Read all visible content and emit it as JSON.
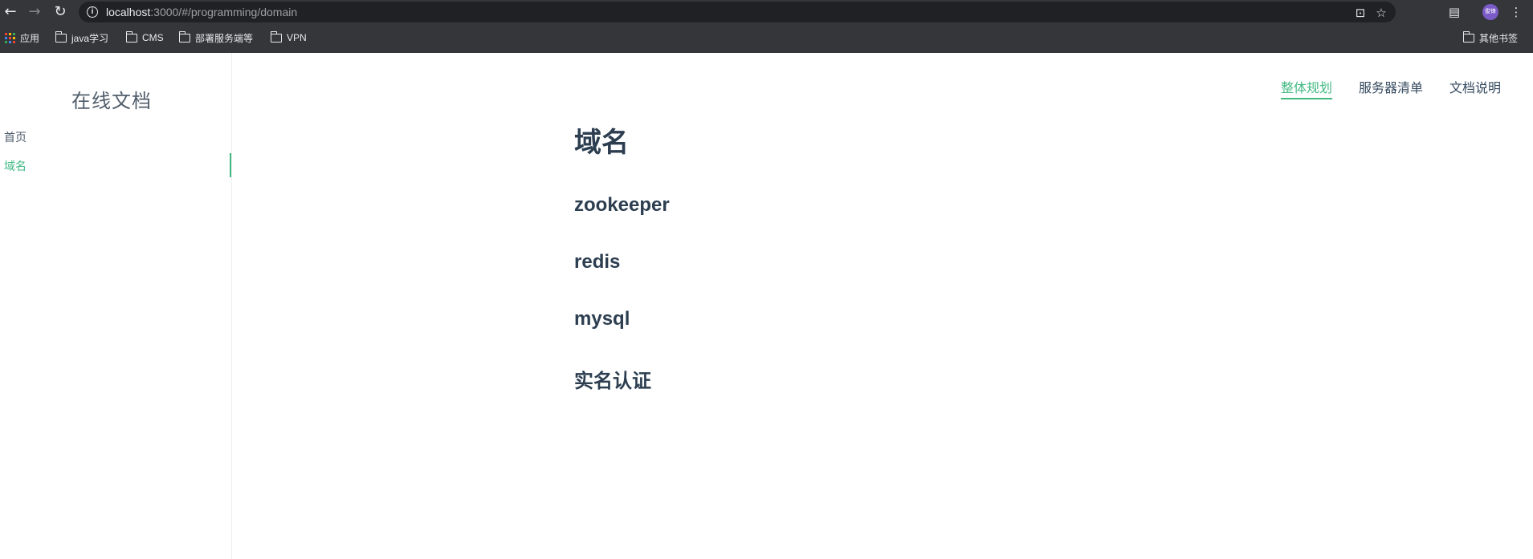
{
  "browser": {
    "url_host": "localhost",
    "url_path": ":3000/#/programming/domain",
    "avatar_text": "俊锋",
    "bookmarks": {
      "apps": "应用",
      "java": "java学习",
      "cms": "CMS",
      "deploy": "部署服务端等",
      "vpn": "VPN",
      "other": "其他书签"
    }
  },
  "sidebar": {
    "app_name": "在线文档",
    "items": [
      {
        "label": "首页"
      },
      {
        "label": "域名"
      }
    ]
  },
  "topnav": {
    "items": [
      {
        "label": "整体规划"
      },
      {
        "label": "服务器清单"
      },
      {
        "label": "文档说明"
      }
    ]
  },
  "content": {
    "title": "域名",
    "sections": [
      "zookeeper",
      "redis",
      "mysql",
      "实名认证"
    ]
  },
  "colors": {
    "accent": "#42b983",
    "text": "#2c3e50",
    "chrome": "#35363a"
  }
}
